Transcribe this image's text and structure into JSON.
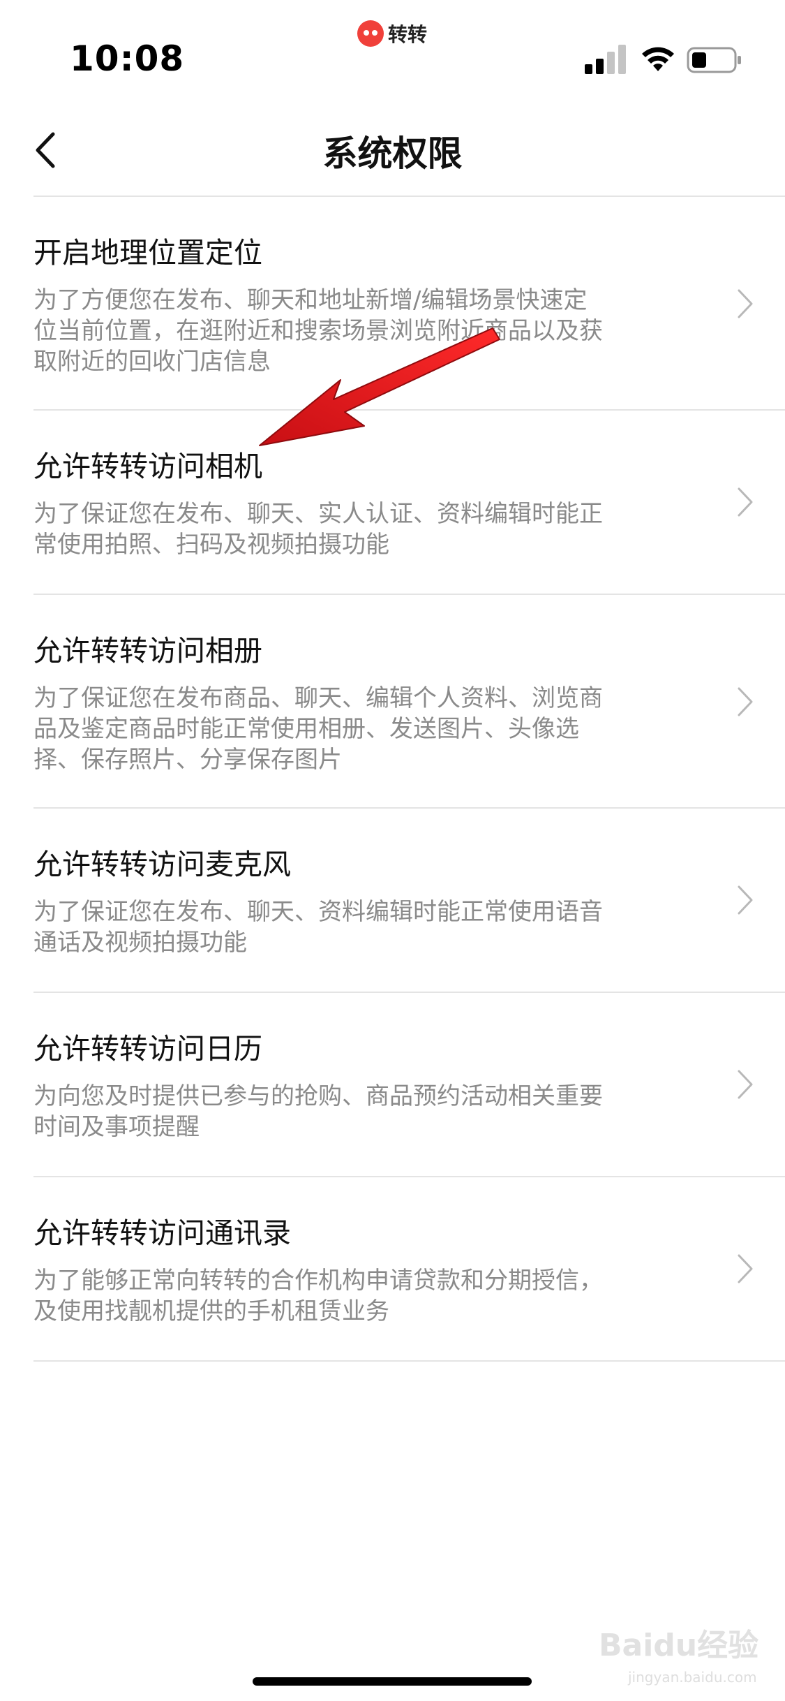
{
  "status_bar": {
    "time": "10:08",
    "app_name": "转转",
    "icons": [
      "signal-icon",
      "wifi-icon",
      "battery-icon"
    ]
  },
  "nav": {
    "title": "系统权限",
    "back_icon": "chevron-left-icon"
  },
  "permissions": [
    {
      "title": "开启地理位置定位",
      "description": "为了方便您在发布、聊天和地址新增/编辑场景快速定位当前位置，在逛附近和搜索场景浏览附近商品以及获取附近的回收门店信息"
    },
    {
      "title": "允许转转访问相机",
      "description": "为了保证您在发布、聊天、实人认证、资料编辑时能正常使用拍照、扫码及视频拍摄功能"
    },
    {
      "title": "允许转转访问相册",
      "description": "为了保证您在发布商品、聊天、编辑个人资料、浏览商品及鉴定商品时能正常使用相册、发送图片、头像选择、保存照片、分享保存图片"
    },
    {
      "title": "允许转转访问麦克风",
      "description": "为了保证您在发布、聊天、资料编辑时能正常使用语音通话及视频拍摄功能"
    },
    {
      "title": "允许转转访问日历",
      "description": "为向您及时提供已参与的抢购、商品预约活动相关重要时间及事项提醒"
    },
    {
      "title": "允许转转访问通讯录",
      "description": "为了能够正常向转转的合作机构申请贷款和分期授信，及使用找靓机提供的手机租赁业务"
    }
  ],
  "watermark": {
    "brand": "Baidu经验",
    "url": "jingyan.baidu.com"
  },
  "colors": {
    "text_primary": "#111111",
    "text_secondary": "#8a8a8a",
    "divider": "#e4e4e4",
    "chevron": "#b8b8b8",
    "annotation_arrow": "#e8141a",
    "brand": "#f0403a"
  }
}
